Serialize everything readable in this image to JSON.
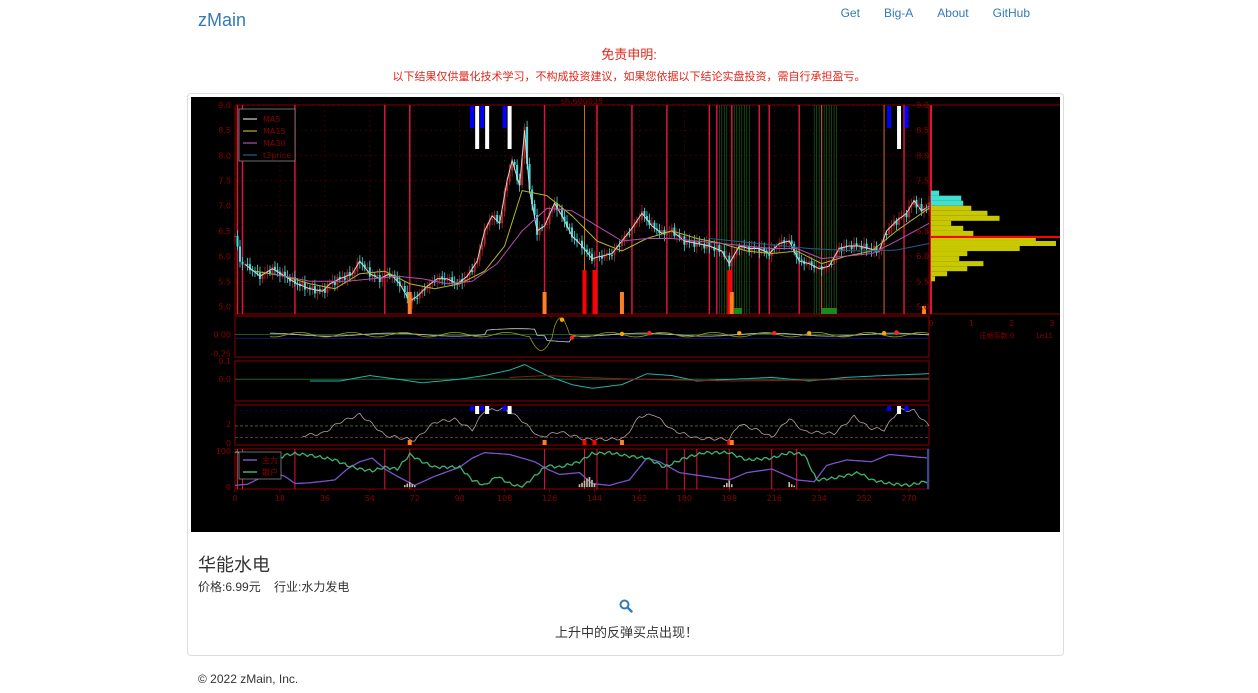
{
  "navbar": {
    "brand": "zMain",
    "links": [
      "Get",
      "Big-A",
      "About",
      "GitHub"
    ]
  },
  "disclaimer": {
    "title": "免责申明:",
    "text": "以下结果仅供量化技术学习，不构成投资建议，如果您依据以下结论实盘投资，需自行承担盈亏。"
  },
  "stock": {
    "name": "华能水电",
    "price_label": "价格:6.99元",
    "industry_label": "行业:水力发电",
    "signal": "上升中的反弹买点出现！",
    "search_icon": "search-icon"
  },
  "footer": {
    "copyright": "© 2022 zMain, Inc."
  },
  "colors": {
    "link": "#337ab7",
    "disclaimer": "#e2241a",
    "axis": "#8b0000",
    "vline": "#dc143c",
    "candle_up": "#b22222",
    "candle_down": "#40e0e0",
    "ma5": "#d3d3d3",
    "ma15": "#b5b52a",
    "ma30": "#b050b0",
    "t3price": "#1f5f8f",
    "profile_upper": "#40e0d0",
    "profile_lower": "#c8c800",
    "poc": "#ff0000",
    "main_force": "#7b52c8",
    "retail": "#3cb371"
  },
  "chart_data": [
    {
      "id": "price",
      "type": "candlestick",
      "title": "sh.600025",
      "ylim": [
        4.85,
        9.0
      ],
      "yticks": [
        5.0,
        5.5,
        6.0,
        6.5,
        7.0,
        7.5,
        8.0,
        8.5,
        9.0
      ],
      "xlim": [
        0,
        278
      ],
      "grid": true,
      "legend": {
        "placement": "top-left",
        "entries": [
          "MA5",
          "MA15",
          "MA30",
          "t3price"
        ]
      },
      "close_anchors": [
        [
          0,
          6.4
        ],
        [
          2,
          5.9
        ],
        [
          5,
          5.8
        ],
        [
          10,
          5.6
        ],
        [
          15,
          5.75
        ],
        [
          20,
          5.6
        ],
        [
          25,
          5.45
        ],
        [
          30,
          5.35
        ],
        [
          35,
          5.3
        ],
        [
          38,
          5.45
        ],
        [
          42,
          5.55
        ],
        [
          47,
          5.65
        ],
        [
          50,
          5.9
        ],
        [
          54,
          5.65
        ],
        [
          58,
          5.55
        ],
        [
          62,
          5.65
        ],
        [
          66,
          5.45
        ],
        [
          70,
          5.1
        ],
        [
          73,
          5.2
        ],
        [
          77,
          5.4
        ],
        [
          81,
          5.55
        ],
        [
          85,
          5.55
        ],
        [
          89,
          5.45
        ],
        [
          93,
          5.6
        ],
        [
          97,
          5.9
        ],
        [
          100,
          6.5
        ],
        [
          103,
          6.8
        ],
        [
          106,
          6.65
        ],
        [
          109,
          7.5
        ],
        [
          111,
          7.9
        ],
        [
          114,
          7.4
        ],
        [
          116,
          8.5
        ],
        [
          118,
          7.3
        ],
        [
          121,
          6.5
        ],
        [
          124,
          6.6
        ],
        [
          128,
          7.05
        ],
        [
          131,
          6.8
        ],
        [
          135,
          6.4
        ],
        [
          139,
          6.2
        ],
        [
          143,
          5.95
        ],
        [
          147,
          6.0
        ],
        [
          151,
          6.05
        ],
        [
          155,
          6.3
        ],
        [
          159,
          6.55
        ],
        [
          163,
          6.85
        ],
        [
          167,
          6.6
        ],
        [
          171,
          6.45
        ],
        [
          175,
          6.5
        ],
        [
          180,
          6.3
        ],
        [
          185,
          6.25
        ],
        [
          190,
          6.2
        ],
        [
          195,
          6.1
        ],
        [
          198,
          5.85
        ],
        [
          202,
          6.2
        ],
        [
          206,
          6.15
        ],
        [
          210,
          6.15
        ],
        [
          214,
          6.05
        ],
        [
          218,
          6.25
        ],
        [
          222,
          6.3
        ],
        [
          226,
          5.9
        ],
        [
          230,
          5.85
        ],
        [
          234,
          5.75
        ],
        [
          238,
          5.8
        ],
        [
          242,
          6.15
        ],
        [
          246,
          6.2
        ],
        [
          250,
          6.2
        ],
        [
          254,
          6.15
        ],
        [
          258,
          6.1
        ],
        [
          261,
          6.5
        ],
        [
          265,
          6.7
        ],
        [
          269,
          6.85
        ],
        [
          272,
          7.1
        ],
        [
          275,
          6.9
        ],
        [
          278,
          6.99
        ]
      ],
      "ma15_anchors": [
        [
          8,
          5.7
        ],
        [
          20,
          5.6
        ],
        [
          30,
          5.45
        ],
        [
          40,
          5.35
        ],
        [
          50,
          5.65
        ],
        [
          60,
          5.7
        ],
        [
          70,
          5.45
        ],
        [
          80,
          5.35
        ],
        [
          90,
          5.45
        ],
        [
          100,
          5.7
        ],
        [
          108,
          6.2
        ],
        [
          115,
          7.3
        ],
        [
          125,
          7.2
        ],
        [
          135,
          6.8
        ],
        [
          145,
          6.3
        ],
        [
          155,
          6.1
        ],
        [
          165,
          6.35
        ],
        [
          175,
          6.5
        ],
        [
          185,
          6.35
        ],
        [
          195,
          6.25
        ],
        [
          205,
          6.1
        ],
        [
          215,
          6.05
        ],
        [
          225,
          6.1
        ],
        [
          235,
          5.85
        ],
        [
          245,
          6.0
        ],
        [
          255,
          6.1
        ],
        [
          265,
          6.5
        ],
        [
          278,
          6.95
        ]
      ],
      "ma30_anchors": [
        [
          15,
          5.65
        ],
        [
          30,
          5.5
        ],
        [
          45,
          5.5
        ],
        [
          55,
          5.55
        ],
        [
          65,
          5.6
        ],
        [
          75,
          5.55
        ],
        [
          85,
          5.45
        ],
        [
          95,
          5.5
        ],
        [
          105,
          5.85
        ],
        [
          115,
          6.5
        ],
        [
          125,
          6.95
        ],
        [
          135,
          6.9
        ],
        [
          145,
          6.6
        ],
        [
          155,
          6.3
        ],
        [
          165,
          6.35
        ],
        [
          175,
          6.35
        ],
        [
          185,
          6.3
        ],
        [
          195,
          6.25
        ],
        [
          205,
          6.2
        ],
        [
          215,
          6.15
        ],
        [
          225,
          6.15
        ],
        [
          235,
          5.95
        ],
        [
          245,
          6.0
        ],
        [
          255,
          6.05
        ],
        [
          265,
          6.3
        ],
        [
          278,
          6.65
        ]
      ],
      "t3price_anchors": [
        [
          190,
          6.35
        ],
        [
          210,
          6.25
        ],
        [
          230,
          6.15
        ],
        [
          250,
          6.1
        ],
        [
          265,
          6.12
        ],
        [
          278,
          6.25
        ]
      ],
      "signal_marks": {
        "blue_bars_x": [
          95,
          99,
          108,
          262,
          269
        ],
        "white_bars_x": [
          97,
          101,
          110,
          266
        ]
      },
      "vertical_lines_x": [
        1,
        3,
        24,
        60,
        70,
        124,
        140,
        145,
        159,
        173,
        190,
        193,
        199,
        210,
        214,
        226,
        235,
        260,
        268
      ],
      "volume_profile": {
        "xlabel": "压缩系数:0",
        "xlim": [
          0,
          3.2
        ],
        "xticks": [
          0,
          1,
          2,
          3
        ],
        "x_exponent": "1e11",
        "poc_price": 6.38,
        "bins": [
          [
            7.25,
            0.2
          ],
          [
            7.15,
            0.75
          ],
          [
            7.05,
            0.8
          ],
          [
            6.95,
            1.0
          ],
          [
            6.85,
            1.4
          ],
          [
            6.75,
            1.7
          ],
          [
            6.65,
            0.5
          ],
          [
            6.55,
            0.8
          ],
          [
            6.45,
            1.05
          ],
          [
            6.35,
            2.6
          ],
          [
            6.25,
            3.1
          ],
          [
            6.15,
            2.2
          ],
          [
            6.05,
            0.9
          ],
          [
            5.95,
            0.7
          ],
          [
            5.85,
            1.3
          ],
          [
            5.75,
            0.9
          ],
          [
            5.65,
            0.4
          ],
          [
            5.55,
            0.1
          ]
        ]
      }
    },
    {
      "id": "oscillator-1",
      "type": "line",
      "ylim": [
        -0.3,
        0.25
      ],
      "yticks": [
        -0.25,
        0.0
      ],
      "series": [
        "white",
        "olive"
      ]
    },
    {
      "id": "oscillator-2",
      "type": "line",
      "ylim": [
        -0.12,
        0.1
      ],
      "yticks": [
        0.0,
        0.1
      ],
      "series": [
        "cyan",
        "dark-red"
      ]
    },
    {
      "id": "oscillator-3",
      "type": "line",
      "ylim": [
        -0.2,
        4.0
      ],
      "yticks": [
        0,
        2
      ],
      "reference_lines": [
        0.6,
        1.8,
        3.4
      ]
    },
    {
      "id": "money-flow",
      "type": "line",
      "ylim": [
        -5,
        105
      ],
      "yticks": [
        0,
        100
      ],
      "legend": {
        "placement": "top-left",
        "entries": [
          "主力",
          "散户"
        ]
      },
      "x_axis_ticks": [
        0,
        18,
        36,
        54,
        72,
        90,
        108,
        126,
        144,
        162,
        180,
        198,
        216,
        234,
        252,
        270
      ],
      "main_force_anchors": [
        [
          0,
          5
        ],
        [
          5,
          8
        ],
        [
          10,
          25
        ],
        [
          15,
          40
        ],
        [
          20,
          30
        ],
        [
          24,
          10
        ],
        [
          30,
          12
        ],
        [
          40,
          20
        ],
        [
          45,
          50
        ],
        [
          50,
          70
        ],
        [
          55,
          80
        ],
        [
          60,
          50
        ],
        [
          65,
          30
        ],
        [
          72,
          5
        ],
        [
          80,
          30
        ],
        [
          90,
          55
        ],
        [
          95,
          80
        ],
        [
          100,
          95
        ],
        [
          110,
          90
        ],
        [
          120,
          70
        ],
        [
          125,
          50
        ],
        [
          130,
          35
        ],
        [
          138,
          40
        ],
        [
          143,
          10
        ],
        [
          150,
          5
        ],
        [
          158,
          20
        ],
        [
          165,
          80
        ],
        [
          170,
          70
        ],
        [
          178,
          40
        ],
        [
          188,
          30
        ],
        [
          198,
          20
        ],
        [
          205,
          40
        ],
        [
          215,
          50
        ],
        [
          225,
          20
        ],
        [
          232,
          15
        ],
        [
          237,
          60
        ],
        [
          245,
          75
        ],
        [
          255,
          70
        ],
        [
          262,
          90
        ],
        [
          270,
          85
        ],
        [
          278,
          80
        ]
      ],
      "retail_anchors": [
        [
          0,
          95
        ],
        [
          5,
          90
        ],
        [
          10,
          80
        ],
        [
          15,
          70
        ],
        [
          20,
          88
        ],
        [
          24,
          92
        ],
        [
          30,
          88
        ],
        [
          40,
          75
        ],
        [
          45,
          60
        ],
        [
          50,
          50
        ],
        [
          55,
          45
        ],
        [
          60,
          55
        ],
        [
          65,
          50
        ],
        [
          70,
          90
        ],
        [
          75,
          70
        ],
        [
          80,
          55
        ],
        [
          90,
          55
        ],
        [
          95,
          20
        ],
        [
          100,
          5
        ],
        [
          105,
          30
        ],
        [
          110,
          10
        ],
        [
          115,
          0
        ],
        [
          120,
          30
        ],
        [
          125,
          60
        ],
        [
          130,
          55
        ],
        [
          138,
          70
        ],
        [
          143,
          92
        ],
        [
          150,
          95
        ],
        [
          158,
          85
        ],
        [
          165,
          80
        ],
        [
          172,
          55
        ],
        [
          180,
          80
        ],
        [
          188,
          95
        ],
        [
          198,
          95
        ],
        [
          205,
          75
        ],
        [
          215,
          80
        ],
        [
          222,
          95
        ],
        [
          228,
          90
        ],
        [
          233,
          20
        ],
        [
          240,
          25
        ],
        [
          250,
          40
        ],
        [
          255,
          20
        ],
        [
          262,
          10
        ],
        [
          270,
          5
        ],
        [
          278,
          18
        ]
      ]
    }
  ]
}
